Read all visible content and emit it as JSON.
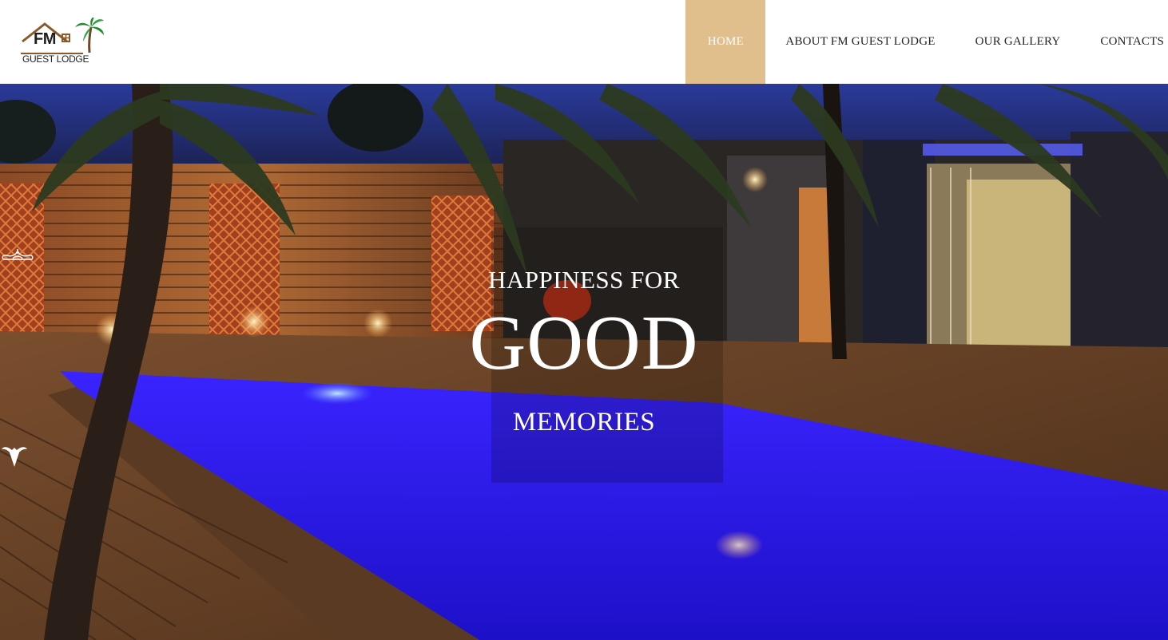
{
  "header": {
    "logo": {
      "mark": "FM",
      "subtitle": "GUEST LODGE"
    },
    "nav": [
      {
        "label": "HOME",
        "active": true
      },
      {
        "label": "ABOUT FM GUEST LODGE",
        "active": false
      },
      {
        "label": "OUR GALLERY",
        "active": false
      },
      {
        "label": "CONTACTS",
        "active": false
      }
    ]
  },
  "hero": {
    "line1": "HAPPINESS FOR",
    "line2": "GOOD",
    "line3": "MEMORIES",
    "ornament_top_icon": "scroll-ornament-icon",
    "ornament_bottom_icon": "fleur-ornament-icon"
  },
  "colors": {
    "accent": "#e1bf8c",
    "pool": "#2a18e6",
    "deck": "#6a4428",
    "text_on_image": "#ffffff"
  }
}
